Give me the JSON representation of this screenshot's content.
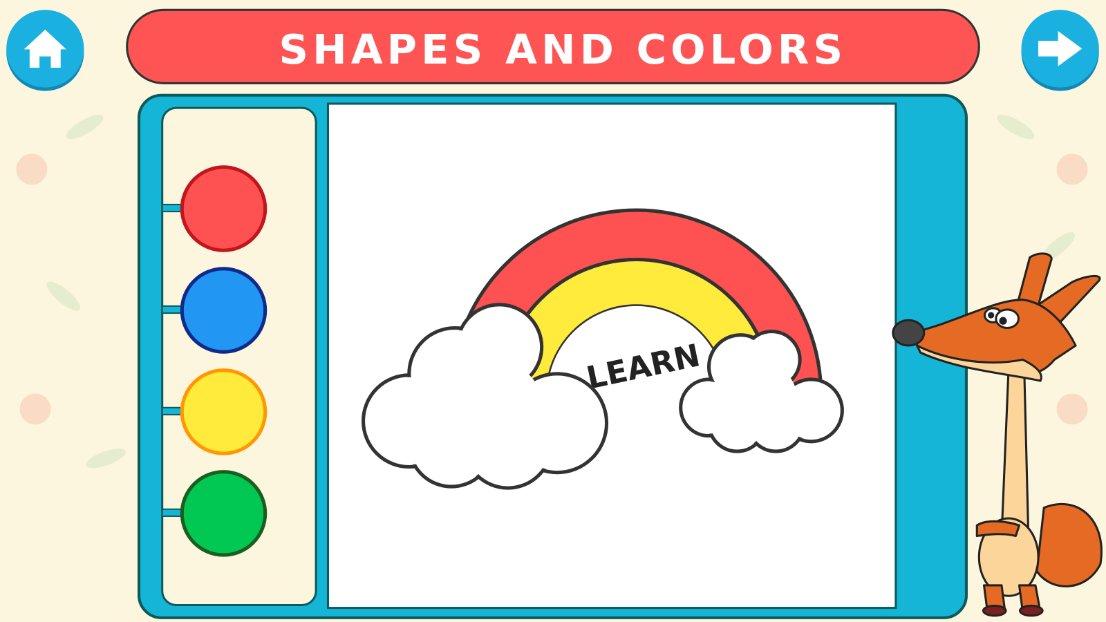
{
  "header": {
    "title": "SHAPES AND COLORS",
    "home_button": {
      "icon": "home-icon"
    },
    "next_button": {
      "icon": "arrow-right-icon"
    }
  },
  "palette": {
    "colors": [
      {
        "name": "red",
        "fill": "#fe5252",
        "border": "#c0161c"
      },
      {
        "name": "blue",
        "fill": "#2196f3",
        "border": "#102a8a"
      },
      {
        "name": "yellow",
        "fill": "#ffeb3b",
        "border": "#ff9800"
      },
      {
        "name": "green",
        "fill": "#00c853",
        "border": "#1b5e20"
      }
    ]
  },
  "canvas": {
    "drawing": "rainbow-with-clouds",
    "label": "LEARN",
    "rainbow_colors": {
      "outer": "#fe5252",
      "middle": "#ffeb3b",
      "inner": "#ffffff"
    }
  },
  "colors": {
    "background": "#fdf6df",
    "title_bar": "#fe5454",
    "panel": "#14b5d6",
    "panel_border": "#0d5a5a",
    "button": "#1ab0e0"
  }
}
